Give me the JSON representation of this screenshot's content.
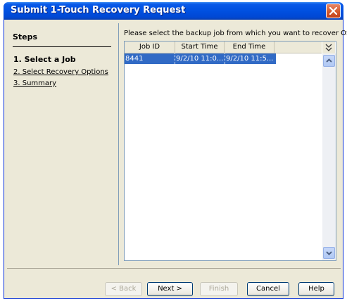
{
  "window": {
    "title": "Submit 1-Touch Recovery Request"
  },
  "steps": {
    "heading": "Steps",
    "items": [
      {
        "label": "1. Select a Job",
        "state": "active"
      },
      {
        "label": "2. Select Recovery Options",
        "state": "link"
      },
      {
        "label": "3. Summary",
        "state": "link"
      }
    ]
  },
  "content": {
    "instruction": "Please select the backup job from which you want to recover OS.",
    "table": {
      "columns": [
        "Job ID",
        "Start Time",
        "End Time"
      ],
      "rows": [
        {
          "job_id": "8441",
          "start_time": "9/2/10 11:0...",
          "end_time": "9/2/10 11:5...",
          "selected": true
        }
      ]
    }
  },
  "buttons": {
    "back": "< Back",
    "next": "Next >",
    "finish": "Finish",
    "cancel": "Cancel",
    "help": "Help"
  },
  "colors": {
    "titlebar": "#0050e0",
    "selection": "#316ac5",
    "window_bg": "#ece9d8"
  }
}
